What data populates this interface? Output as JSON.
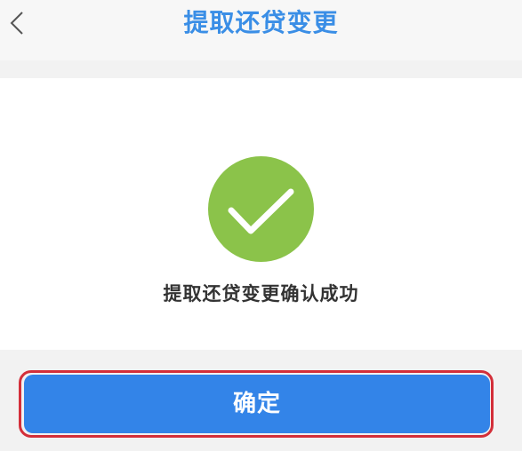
{
  "header": {
    "title": "提取还贷变更",
    "back_icon": "chevron-left-icon"
  },
  "result": {
    "status_icon": "checkmark-circle-icon",
    "message": "提取还贷变更确认成功"
  },
  "actions": {
    "confirm_label": "确定"
  },
  "colors": {
    "title": "#3a8ee6",
    "success": "#8bc34a",
    "button": "#3384e8",
    "highlight_outline": "#d32f3a"
  }
}
